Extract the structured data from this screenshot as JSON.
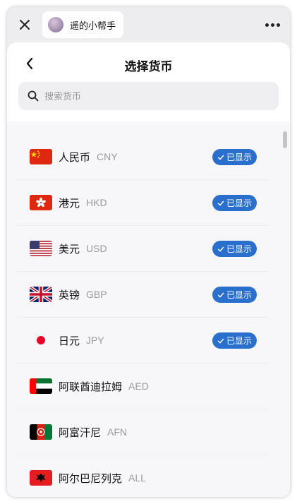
{
  "app": {
    "name": "遥的小帮手"
  },
  "sheet": {
    "title": "选择货币"
  },
  "search": {
    "placeholder": "搜索货币"
  },
  "colors": {
    "accent": "#2a6fcb"
  },
  "currencies": [
    {
      "name": "人民币",
      "code": "CNY",
      "flag": "china-flag-icon",
      "badge": "已显示"
    },
    {
      "name": "港元",
      "code": "HKD",
      "flag": "hong-kong-flag-icon",
      "badge": "已显示"
    },
    {
      "name": "美元",
      "code": "USD",
      "flag": "usa-flag-icon",
      "badge": "已显示"
    },
    {
      "name": "英镑",
      "code": "GBP",
      "flag": "uk-flag-icon",
      "badge": "已显示"
    },
    {
      "name": "日元",
      "code": "JPY",
      "flag": "japan-flag-icon",
      "badge": "已显示"
    },
    {
      "name": "阿联酋迪拉姆",
      "code": "AED",
      "flag": "uae-flag-icon"
    },
    {
      "name": "阿富汗尼",
      "code": "AFN",
      "flag": "afghanistan-flag-icon"
    },
    {
      "name": "阿尔巴尼列克",
      "code": "ALL",
      "flag": "albania-flag-icon"
    }
  ]
}
